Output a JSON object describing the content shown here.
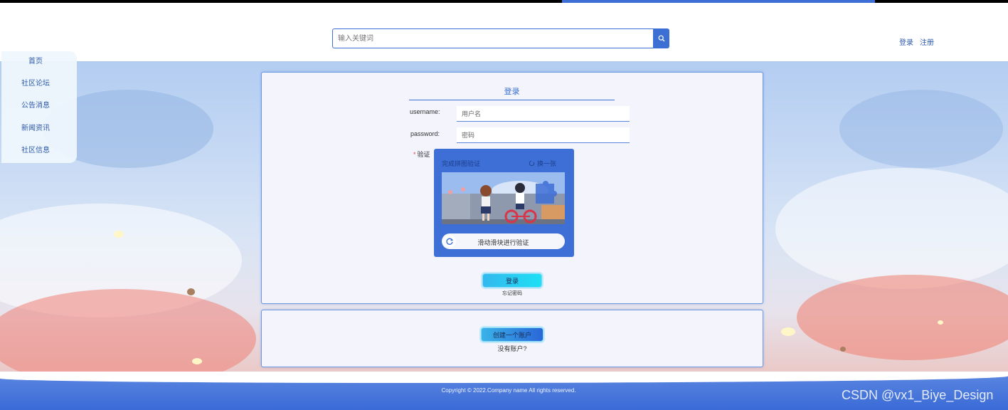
{
  "header": {
    "search_placeholder": "输入关键词",
    "login_link": "登录",
    "register_link": "注册"
  },
  "sidebar": {
    "items": [
      {
        "label": "首页"
      },
      {
        "label": "社区论坛"
      },
      {
        "label": "公告消息"
      },
      {
        "label": "新闻资讯"
      },
      {
        "label": "社区信息"
      }
    ]
  },
  "login_form": {
    "title": "登录",
    "username_label": "username:",
    "username_placeholder": "用户名",
    "password_label": "password:",
    "password_placeholder": "密码",
    "captcha_label": "验证",
    "captcha_required_mark": "*"
  },
  "captcha": {
    "heading": "完成拼图验证",
    "refresh_label": "换一张",
    "slider_text": "滑动滑块进行验证"
  },
  "actions": {
    "login_button": "登录",
    "forgot_password": "忘记密码",
    "create_account_button": "创建一个账户",
    "no_account_text": "没有账户?"
  },
  "footer": {
    "copyright": "Copyright © 2022.Company name All rights reserved.",
    "watermark": "CSDN @vx1_Biye_Design"
  },
  "colors": {
    "accent": "#3b6fd4",
    "link": "#2e5aa8",
    "button_gradient_start": "#33b8ee",
    "button_gradient_end": "#1ee0f4"
  }
}
